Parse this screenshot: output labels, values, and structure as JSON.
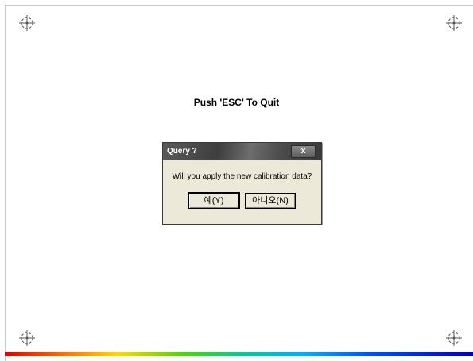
{
  "screen": {
    "instruction": "Push 'ESC' To Quit",
    "targets": [
      {
        "icon": "crosshair-target-icon"
      },
      {
        "icon": "crosshair-target-icon"
      },
      {
        "icon": "crosshair-target-icon"
      },
      {
        "icon": "crosshair-target-icon"
      }
    ],
    "gradient_colors": [
      "#e00000",
      "#ff6a00",
      "#ffd800",
      "#4cd800",
      "#00c8a0",
      "#00b0ff",
      "#0050ff",
      "#0000c8"
    ]
  },
  "dialog": {
    "title": "Query ?",
    "close_icon": "close-icon",
    "close_label": "x",
    "message": "Will you apply the new calibration data?",
    "yes_label": "예(Y)",
    "no_label": "아니오(N)"
  }
}
